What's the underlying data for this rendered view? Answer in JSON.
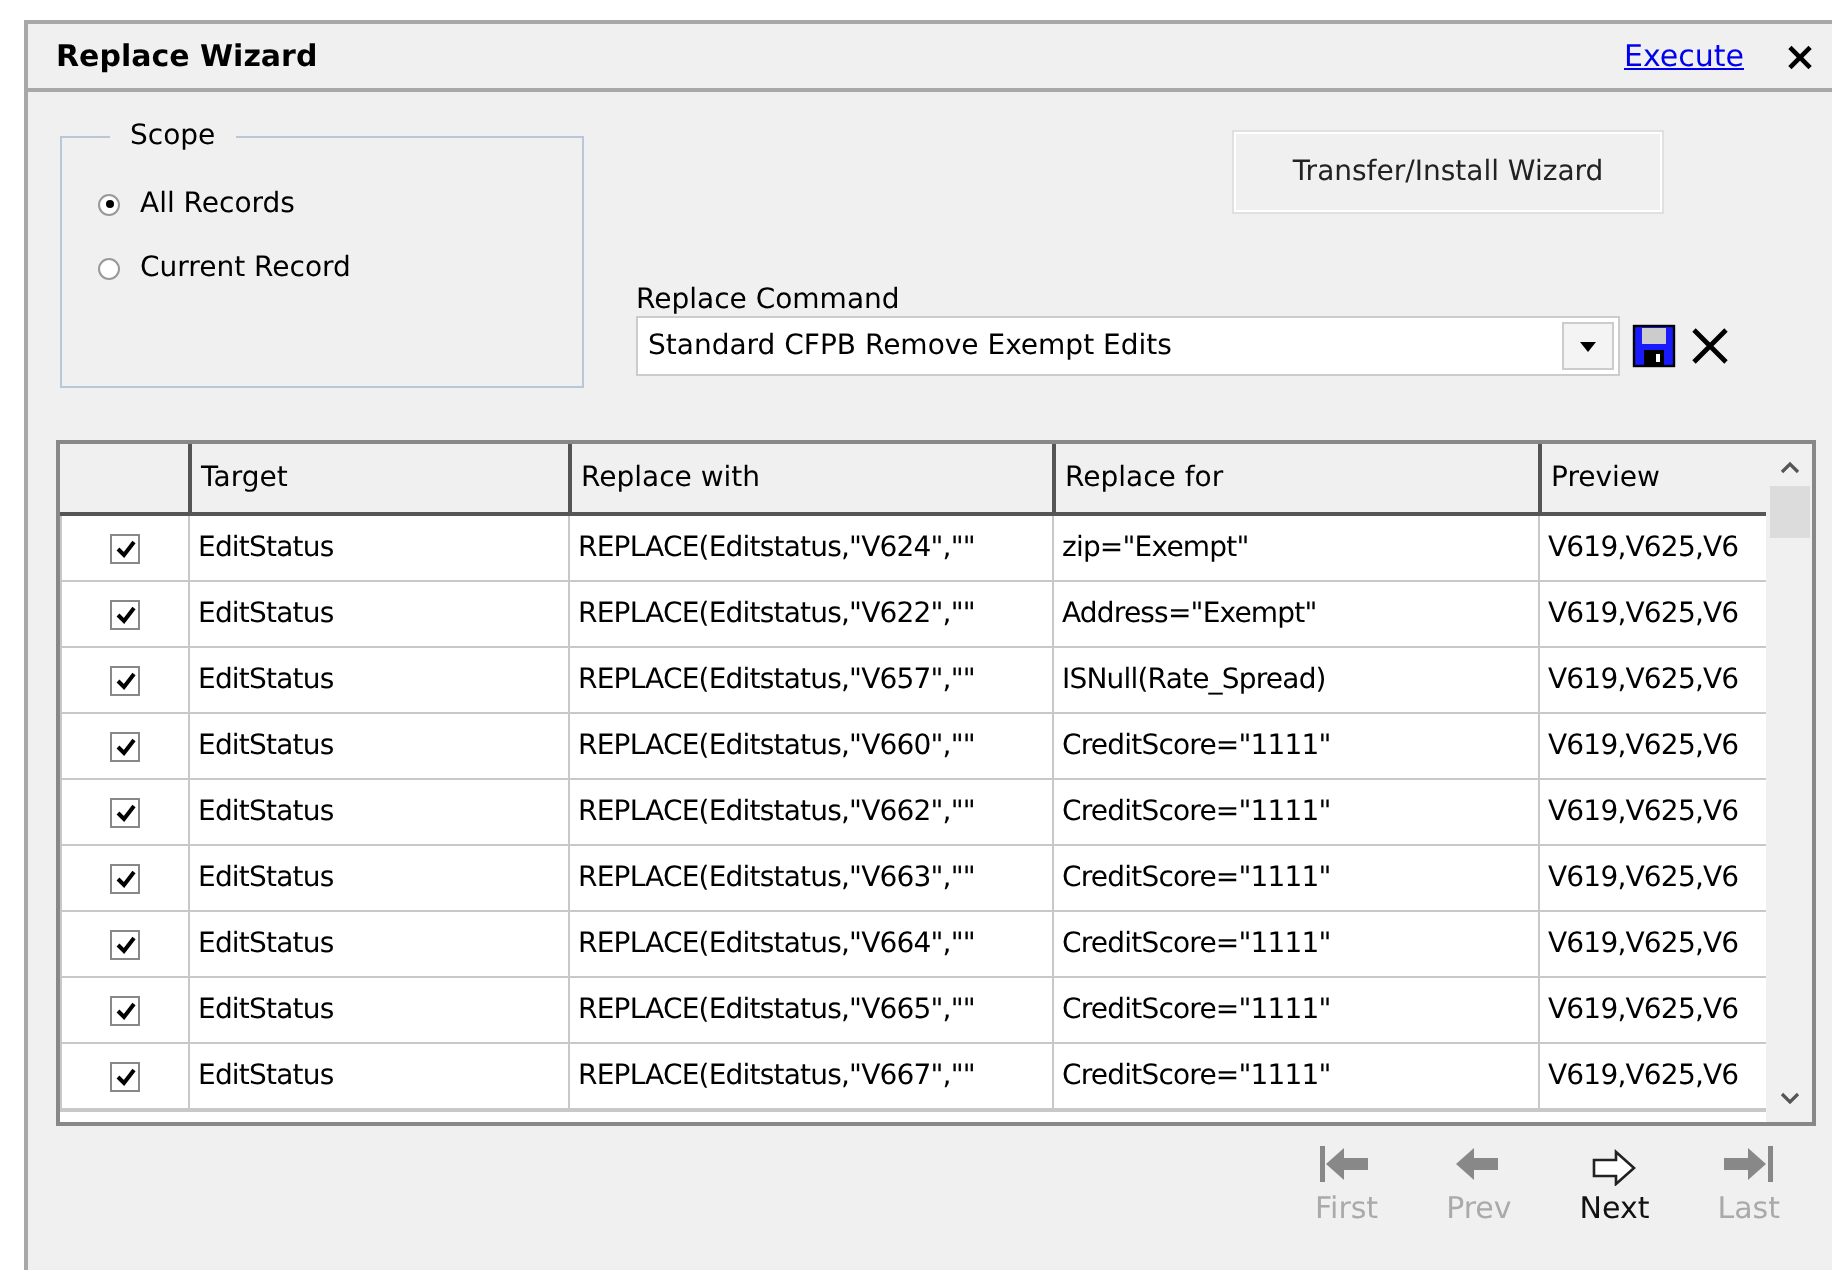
{
  "window": {
    "title": "Replace Wizard",
    "execute_link": "Execute",
    "close_label": "×"
  },
  "scope": {
    "legend": "Scope",
    "options": [
      {
        "label": "All Records",
        "selected": true
      },
      {
        "label": "Current Record",
        "selected": false
      }
    ]
  },
  "transfer_button": "Transfer/Install Wizard",
  "replace_command": {
    "label": "Replace Command",
    "value": "Standard CFPB Remove Exempt Edits"
  },
  "table": {
    "columns": [
      "Target",
      "Replace with",
      "Replace for",
      "Preview"
    ],
    "rows": [
      {
        "checked": true,
        "target": "EditStatus",
        "replace_with": "REPLACE(Editstatus,\"V624\",\"\"",
        "replace_for": "zip=\"Exempt\"",
        "preview": "V619,V625,V6"
      },
      {
        "checked": true,
        "target": "EditStatus",
        "replace_with": "REPLACE(Editstatus,\"V622\",\"\"",
        "replace_for": "Address=\"Exempt\"",
        "preview": "V619,V625,V6"
      },
      {
        "checked": true,
        "target": "EditStatus",
        "replace_with": "REPLACE(Editstatus,\"V657\",\"\"",
        "replace_for": "ISNull(Rate_Spread)",
        "preview": "V619,V625,V6"
      },
      {
        "checked": true,
        "target": "EditStatus",
        "replace_with": "REPLACE(Editstatus,\"V660\",\"\"",
        "replace_for": "CreditScore=\"1111\"",
        "preview": "V619,V625,V6"
      },
      {
        "checked": true,
        "target": "EditStatus",
        "replace_with": "REPLACE(Editstatus,\"V662\",\"\"",
        "replace_for": "CreditScore=\"1111\"",
        "preview": "V619,V625,V6"
      },
      {
        "checked": true,
        "target": "EditStatus",
        "replace_with": "REPLACE(Editstatus,\"V663\",\"\"",
        "replace_for": "CreditScore=\"1111\"",
        "preview": "V619,V625,V6"
      },
      {
        "checked": true,
        "target": "EditStatus",
        "replace_with": "REPLACE(Editstatus,\"V664\",\"\"",
        "replace_for": "CreditScore=\"1111\"",
        "preview": "V619,V625,V6"
      },
      {
        "checked": true,
        "target": "EditStatus",
        "replace_with": "REPLACE(Editstatus,\"V665\",\"\"",
        "replace_for": "CreditScore=\"1111\"",
        "preview": "V619,V625,V6"
      },
      {
        "checked": true,
        "target": "EditStatus",
        "replace_with": "REPLACE(Editstatus,\"V667\",\"\"",
        "replace_for": "CreditScore=\"1111\"",
        "preview": "V619,V625,V6"
      }
    ]
  },
  "navigation": [
    {
      "kind": "first",
      "label": "First",
      "disabled": true
    },
    {
      "kind": "prev",
      "label": "Prev",
      "disabled": true
    },
    {
      "kind": "next",
      "label": "Next",
      "disabled": false
    },
    {
      "kind": "last",
      "label": "Last",
      "disabled": true
    }
  ]
}
